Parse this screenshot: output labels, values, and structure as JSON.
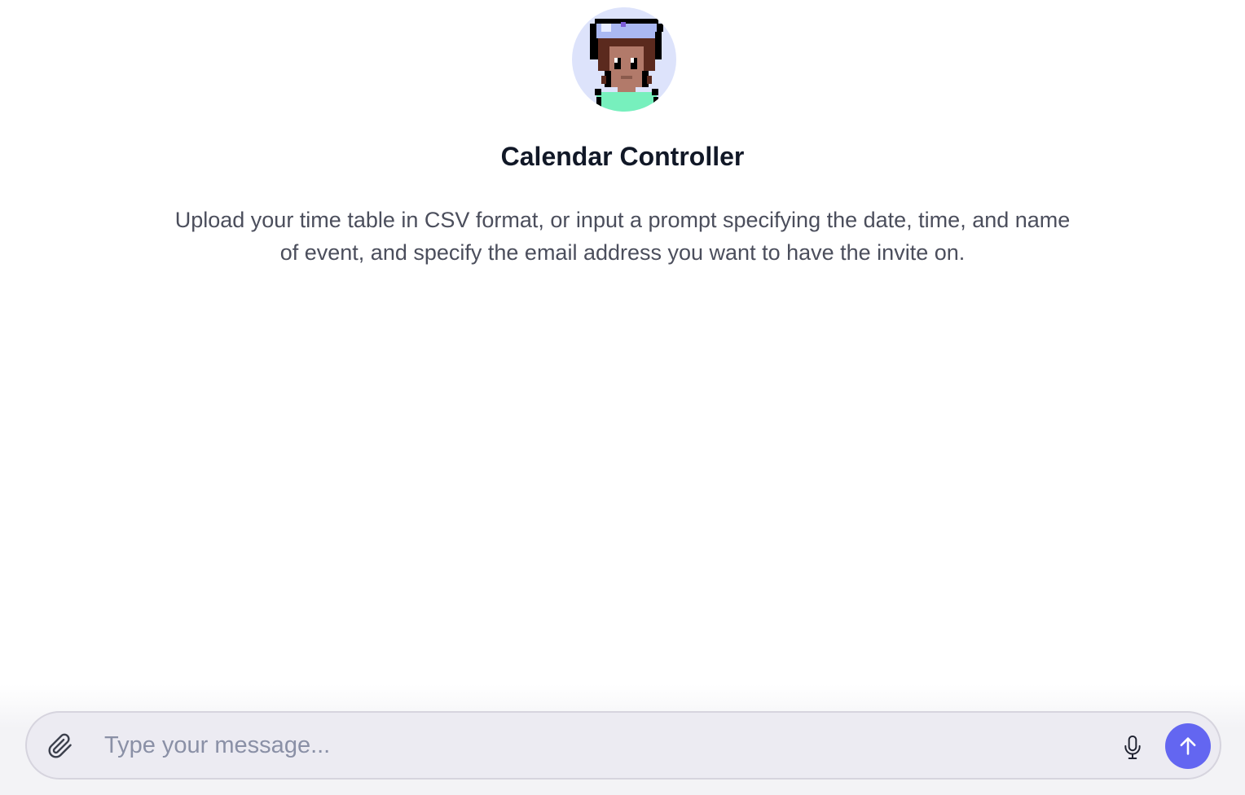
{
  "agent": {
    "avatar_icon": "pixel-art-character-avatar",
    "name": "Calendar Controller",
    "description": "Upload your time table in CSV format, or input a prompt specifying the date, time, and name of event, and specify the email address you want to have the invite on."
  },
  "composer": {
    "placeholder": "Type your message...",
    "value": "",
    "attach_icon": "paperclip-icon",
    "mic_icon": "microphone-icon",
    "send_icon": "arrow-up-icon"
  },
  "colors": {
    "accent": "#6366f1",
    "avatar_background": "#dde3fb",
    "composer_background": "#ecebf2"
  }
}
